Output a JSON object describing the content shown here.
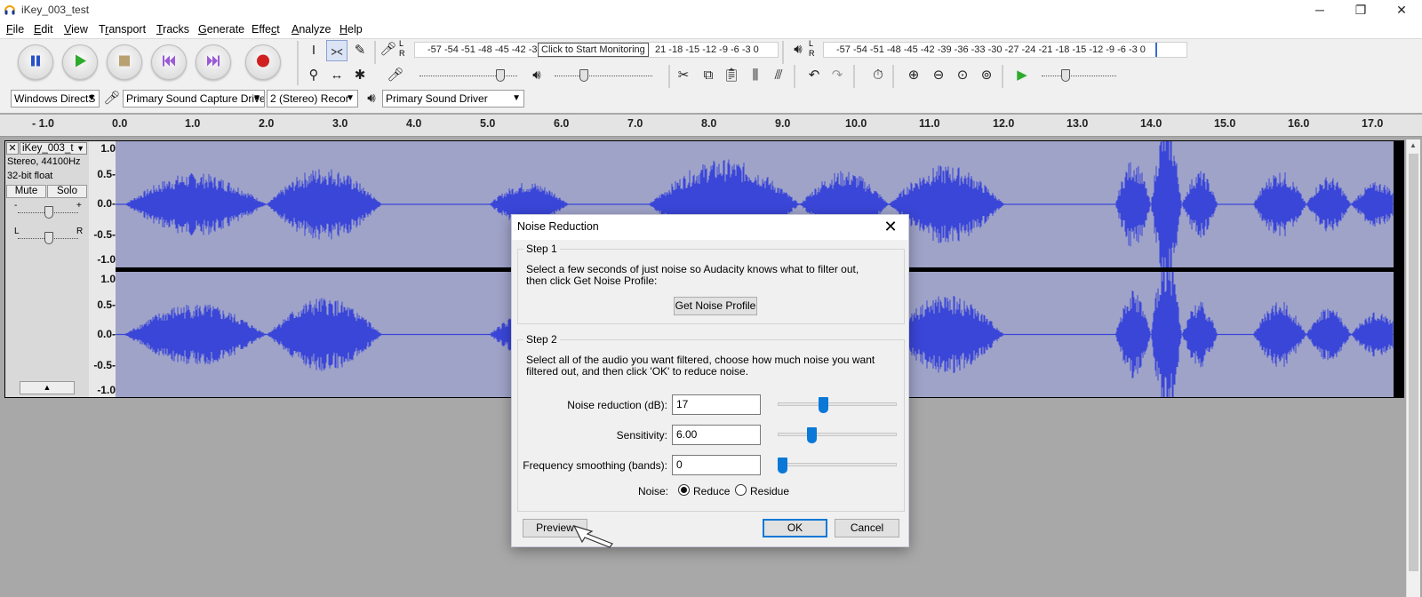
{
  "window": {
    "title": "iKey_003_test",
    "minimize_icon": "─",
    "restore_icon": "❐",
    "close_icon": "✕"
  },
  "menu": [
    {
      "label": "File",
      "acc": "F"
    },
    {
      "label": "Edit",
      "acc": "E"
    },
    {
      "label": "View",
      "acc": "V"
    },
    {
      "label": "Transport",
      "acc": "r"
    },
    {
      "label": "Tracks",
      "acc": "T"
    },
    {
      "label": "Generate",
      "acc": "G"
    },
    {
      "label": "Effect",
      "acc": "c"
    },
    {
      "label": "Analyze",
      "acc": "A"
    },
    {
      "label": "Help",
      "acc": "H"
    }
  ],
  "toolbar": {
    "record_meter": {
      "l_label": "L",
      "r_label": "R",
      "scale": "-57 -54 -51 -48 -45 -42 -3",
      "scale_right": "21 -18 -15 -12 -9 -6 -3 0",
      "tooltip": "Click to Start Monitoring"
    },
    "playback_meter": {
      "scale": "-57 -54 -51 -48 -45 -42 -39 -36 -33 -30 -27 -24 -21 -18 -15 -12 -9 -6 -3 0"
    },
    "device": {
      "host": "Windows DirectS",
      "recording_device": "Primary Sound Capture Drive",
      "channels": "2 (Stereo) Recor",
      "playback_device": "Primary Sound Driver"
    }
  },
  "ruler": {
    "ticks": [
      "- 1.0",
      "0.0",
      "1.0",
      "2.0",
      "3.0",
      "4.0",
      "5.0",
      "6.0",
      "7.0",
      "8.0",
      "9.0",
      "10.0",
      "11.0",
      "12.0",
      "13.0",
      "14.0",
      "15.0",
      "16.0",
      "17.0"
    ]
  },
  "track": {
    "name": "iKey_003_t",
    "info1": "Stereo, 44100Hz",
    "info2": "32-bit float",
    "mute": "Mute",
    "solo": "Solo",
    "gain_minus": "-",
    "gain_plus": "+",
    "pan_l": "L",
    "pan_r": "R",
    "collapse": "▲",
    "scale": [
      "1.0",
      "0.5-",
      "0.0-",
      "-0.5-",
      "-1.0"
    ]
  },
  "dialog": {
    "title": "Noise Reduction",
    "close": "✕",
    "step1": {
      "label": "Step 1",
      "text1": "Select a few seconds of just noise so Audacity knows what to filter out,",
      "text2": "then click Get Noise Profile:",
      "button": "Get Noise Profile"
    },
    "step2": {
      "label": "Step 2",
      "text1": "Select all of the audio you want filtered, choose how much noise you want",
      "text2": "filtered out, and then click 'OK' to reduce noise."
    },
    "fields": [
      {
        "label": "Noise reduction (dB):",
        "value": "17",
        "level": 0.37
      },
      {
        "label": "Sensitivity:",
        "value": "6.00",
        "level": 0.27
      },
      {
        "label": "Frequency smoothing (bands):",
        "value": "0",
        "level": 0.0
      }
    ],
    "noise_label": "Noise:",
    "reduce": "Reduce",
    "residue": "Residue",
    "preview": "Preview",
    "ok": "OK",
    "cancel": "Cancel"
  }
}
